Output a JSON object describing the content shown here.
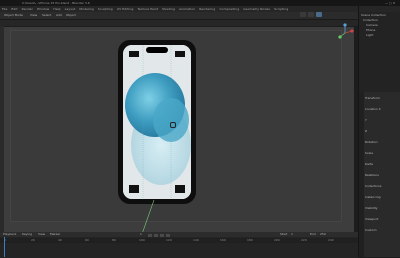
{
  "window": {
    "title": "C:\\Users\\...\\iPhone 15 Pro.blend - Blender 3.6"
  },
  "menubar": {
    "items": [
      "File",
      "Edit",
      "Render",
      "Window",
      "Help",
      "Layout",
      "Modeling",
      "Sculpting",
      "UV Editing",
      "Texture Paint",
      "Shading",
      "Animation",
      "Rendering",
      "Compositing",
      "Geometry Nodes",
      "Scripting"
    ]
  },
  "viewport": {
    "mode": "Object Mode",
    "view_menu": "View",
    "select_menu": "Select",
    "add_menu": "Add",
    "object_menu": "Object"
  },
  "outliner": {
    "header": "Scene Collection",
    "items": [
      "Collection",
      "Camera",
      "Phone",
      "Light"
    ]
  },
  "properties": {
    "rows": [
      "Transform",
      "Location X",
      "Y",
      "Z",
      "Rotation",
      "Scale",
      "Delta",
      "Relations",
      "Collections",
      "Instancing",
      "Visibility",
      "Viewport",
      "Custom"
    ]
  },
  "timeline": {
    "playback": "Playback",
    "keying": "Keying",
    "view": "View",
    "marker": "Marker",
    "frame_current": "1",
    "start_label": "Start",
    "start": "1",
    "end_label": "End",
    "end": "250",
    "ruler": [
      "0",
      "20",
      "40",
      "60",
      "80",
      "100",
      "120",
      "140",
      "160",
      "180",
      "200",
      "220",
      "240"
    ]
  },
  "colors": {
    "accent": "#3d7ec2",
    "phone_blob": "#5ab0cc",
    "background": "#3d3d3d"
  }
}
